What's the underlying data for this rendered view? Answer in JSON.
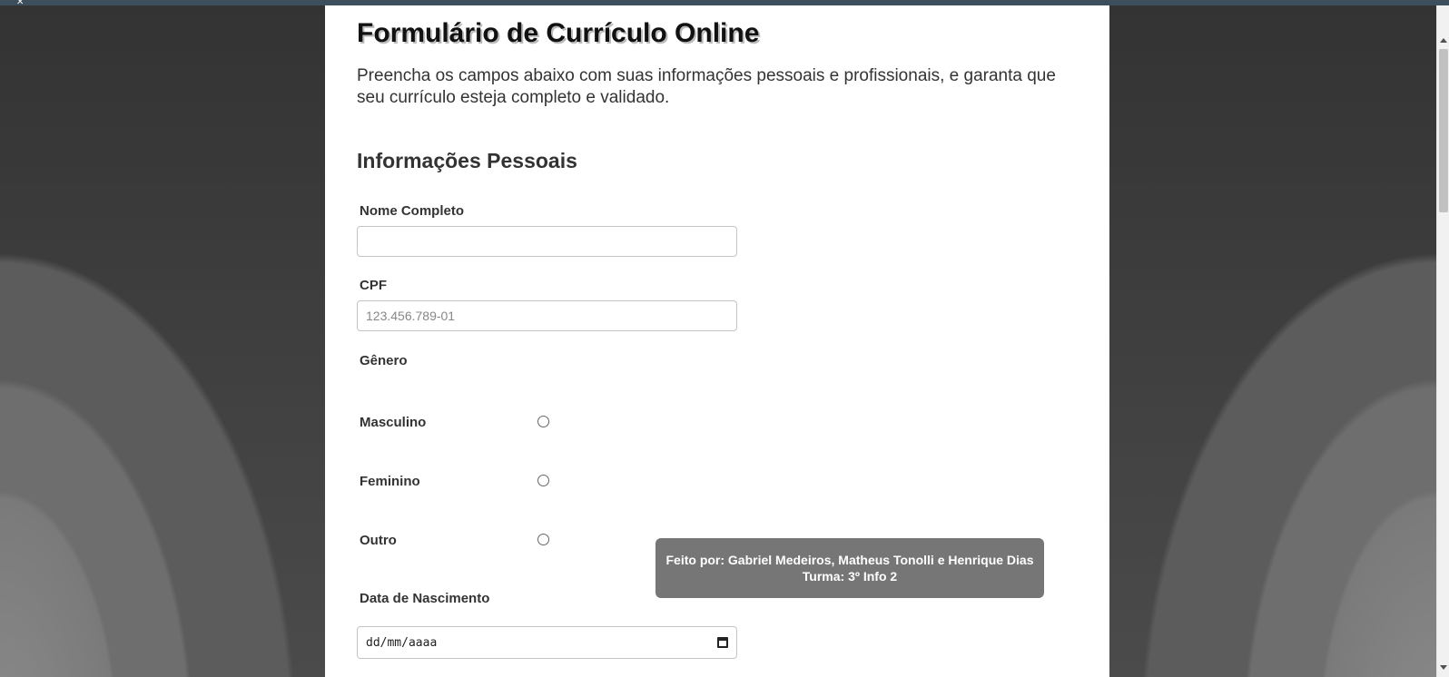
{
  "page": {
    "title": "Formulário de Currículo Online",
    "intro": "Preencha os campos abaixo com suas informações pessoais e profissionais, e garanta que seu currículo esteja completo e validado."
  },
  "personal": {
    "section_title": "Informações Pessoais",
    "name_label": "Nome Completo",
    "name_value": "",
    "cpf_label": "CPF",
    "cpf_placeholder": "123.456.789-01",
    "gender_label": "Gênero",
    "gender_options": [
      "Masculino",
      "Feminino",
      "Outro"
    ],
    "birth_label": "Data de Nascimento",
    "birth_placeholder": "dd/mm/aaaa"
  },
  "credits": {
    "line1": "Feito por: Gabriel Medeiros, Matheus Tonolli e Henrique Dias",
    "line2": "Turma: 3º Info 2"
  },
  "colors": {
    "panel_bg": "#ffffff",
    "credits_bg": "#767676",
    "topbar": "#3d4f5c"
  }
}
